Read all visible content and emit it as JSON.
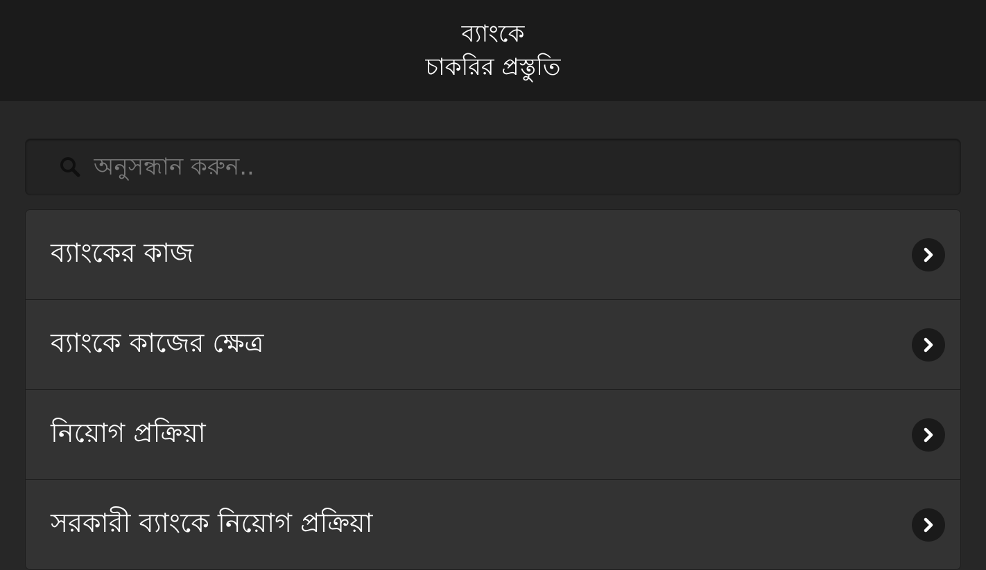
{
  "header": {
    "title_line1": "ব্যাংকে",
    "title_line2": "চাকরির প্রস্তুতি"
  },
  "search": {
    "placeholder": "অনুসন্ধান করুন.."
  },
  "list": {
    "items": [
      {
        "label": "ব্যাংকের কাজ"
      },
      {
        "label": "ব্যাংকে কাজের ক্ষেত্র"
      },
      {
        "label": "নিয়োগ প্রক্রিয়া"
      },
      {
        "label": "সরকারী ব্যাংকে নিয়োগ প্রক্রিয়া"
      }
    ]
  },
  "icons": {
    "search": "search-icon",
    "chevron": "chevron-right-icon"
  },
  "colors": {
    "header_bg": "#1b1b1b",
    "page_bg": "#272727",
    "item_bg": "#333333",
    "chevron_bg": "#1a1a1a",
    "text": "#ffffff",
    "placeholder": "#7a7a7a"
  }
}
